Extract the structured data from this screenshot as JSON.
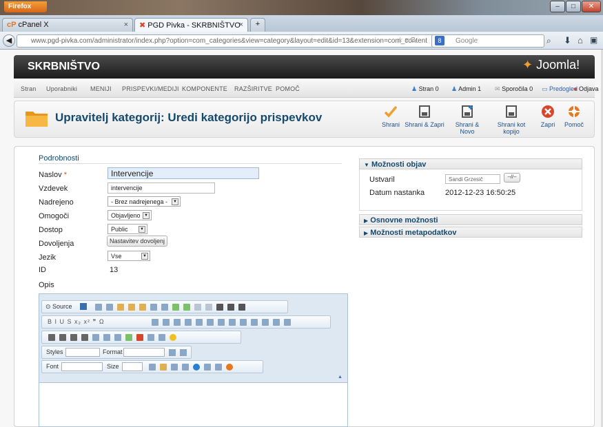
{
  "browser": {
    "app_button": "Firefox",
    "tabs": [
      {
        "label": "cPanel X"
      },
      {
        "label": "PGD Pivka - SKRBNIŠTVO"
      }
    ],
    "url": "www.pgd-pivka.com/administrator/index.php?option=com_categories&view=category&layout=edit&id=13&extension=com_content",
    "search_placeholder": "Google"
  },
  "header": {
    "site_title": "SKRBNIŠTVO",
    "logo_text": "Joomla!"
  },
  "menu": {
    "items": [
      "Stran",
      "Uporabniki",
      "MENIJI",
      "PRISPEVKI/MEDIJI",
      "KOMPONENTE",
      "RAZŠIRITVE",
      "POMOČ"
    ],
    "status": {
      "stran": "Stran 0",
      "admin": "Admin 1",
      "sporocila": "Sporočila 0",
      "predogled": "Predogled",
      "odjava": "Odjava"
    }
  },
  "toolbar": {
    "page_title": "Upravitelj kategorij: Uredi kategorijo prispevkov",
    "buttons": [
      {
        "label": "Shrani"
      },
      {
        "label": "Shrani & Zapri"
      },
      {
        "label": "Shrani & Novo"
      },
      {
        "label": "Shrani kot kopijo"
      },
      {
        "label": "Zapri"
      },
      {
        "label": "Pomoč"
      }
    ]
  },
  "form": {
    "legend": "Podrobnosti",
    "naslov_label": "Naslov",
    "naslov_value": "Intervencije",
    "vzdevek_label": "Vzdevek",
    "vzdevek_value": "intervencije",
    "nadrejeno_label": "Nadrejeno",
    "nadrejeno_value": "- Brez nadrejenega -",
    "omogoci_label": "Omogoči",
    "omogoci_value": "Objavljeno",
    "dostop_label": "Dostop",
    "dostop_value": "Public",
    "dovoljenja_label": "Dovoljenja",
    "dovoljenja_button": "Nastavitev dovoljenj",
    "jezik_label": "Jezik",
    "jezik_value": "Vse",
    "id_label": "ID",
    "id_value": "13",
    "opis_label": "Opis"
  },
  "publish_panel": {
    "title": "Možnosti objav",
    "ustvaril_label": "Ustvaril",
    "ustvaril_value": "Sandi Grzesič",
    "select_user_button": "--//--",
    "datum_label": "Datum nastanka",
    "datum_value": "2012-12-23 16:50:25"
  },
  "basic_panel": {
    "title": "Osnovne možnosti"
  },
  "meta_panel": {
    "title": "Možnosti metapodatkov"
  },
  "editor": {
    "source_label": "Source",
    "styles_label": "Styles",
    "format_label": "Format",
    "font_label": "Font",
    "size_label": "Size",
    "row2_marks": "B  I  U  S  x₂  x²  ❞  Ω"
  },
  "colors": {
    "title_blue": "#15496d",
    "header_dark": "#1c1c1c",
    "save_orange": "#f0a028",
    "close_red": "#d9452a"
  }
}
